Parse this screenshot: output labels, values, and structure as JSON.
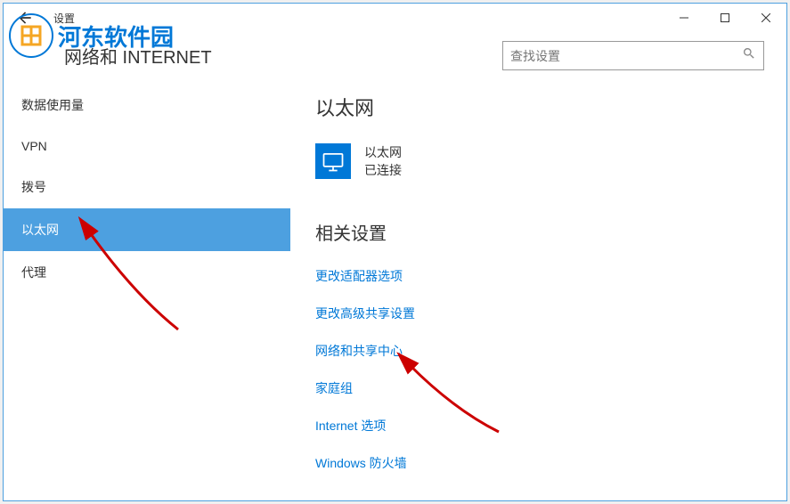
{
  "window": {
    "title": "设置",
    "subtitle": "网络和 INTERNET",
    "search_placeholder": "查找设置"
  },
  "sidebar": {
    "items": [
      {
        "label": "数据使用量"
      },
      {
        "label": "VPN"
      },
      {
        "label": "拨号"
      },
      {
        "label": "以太网",
        "active": true
      },
      {
        "label": "代理"
      }
    ]
  },
  "content": {
    "heading": "以太网",
    "network": {
      "name": "以太网",
      "status": "已连接"
    },
    "related_heading": "相关设置",
    "links": [
      {
        "label": "更改适配器选项"
      },
      {
        "label": "更改高级共享设置"
      },
      {
        "label": "网络和共享中心"
      },
      {
        "label": "家庭组"
      },
      {
        "label": "Internet 选项"
      },
      {
        "label": "Windows 防火墙"
      }
    ]
  },
  "watermark": {
    "text": "河东软件园"
  }
}
